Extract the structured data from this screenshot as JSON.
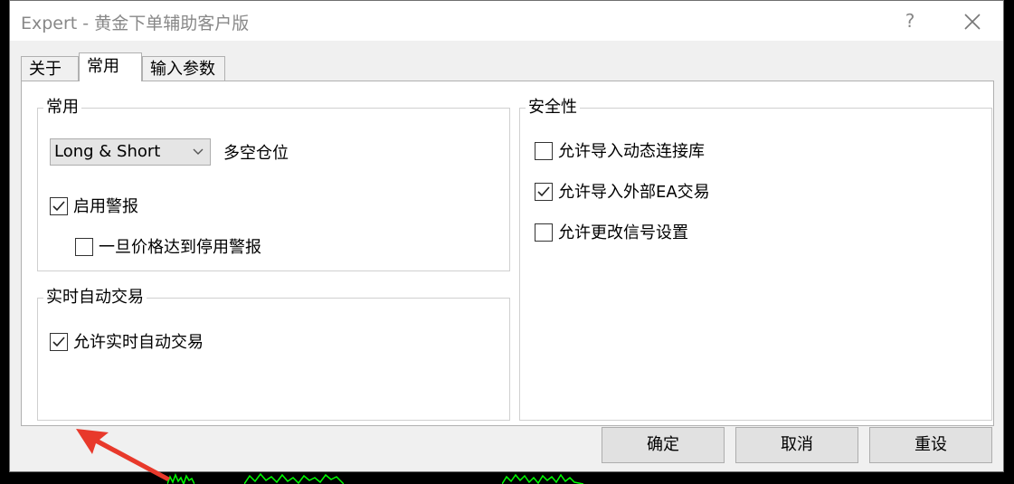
{
  "window": {
    "title": "Expert - 黄金下单辅助客户版",
    "help_label": "?"
  },
  "tabs": [
    {
      "label": "关于"
    },
    {
      "label": "常用"
    },
    {
      "label": "输入参数"
    }
  ],
  "common_group": {
    "title": "常用",
    "position_select": {
      "value": "Long & Short"
    },
    "position_label": "多空仓位",
    "enable_alerts": {
      "label": "启用警报",
      "checked": true
    },
    "disable_on_price": {
      "label": "一旦价格达到停用警报",
      "checked": false
    }
  },
  "realtime_group": {
    "title": "实时自动交易",
    "allow_realtime": {
      "label": "允许实时自动交易",
      "checked": true
    }
  },
  "security_group": {
    "title": "安全性",
    "allow_dll": {
      "label": "允许导入动态连接库",
      "checked": false
    },
    "allow_ea": {
      "label": "允许导入外部EA交易",
      "checked": true
    },
    "allow_signal": {
      "label": "允许更改信号设置",
      "checked": false
    }
  },
  "buttons": {
    "ok": "确定",
    "cancel": "取消",
    "reset": "重设"
  },
  "colors": {
    "accent_arrow": "#e8392b",
    "chart_green": "#00ff00"
  }
}
